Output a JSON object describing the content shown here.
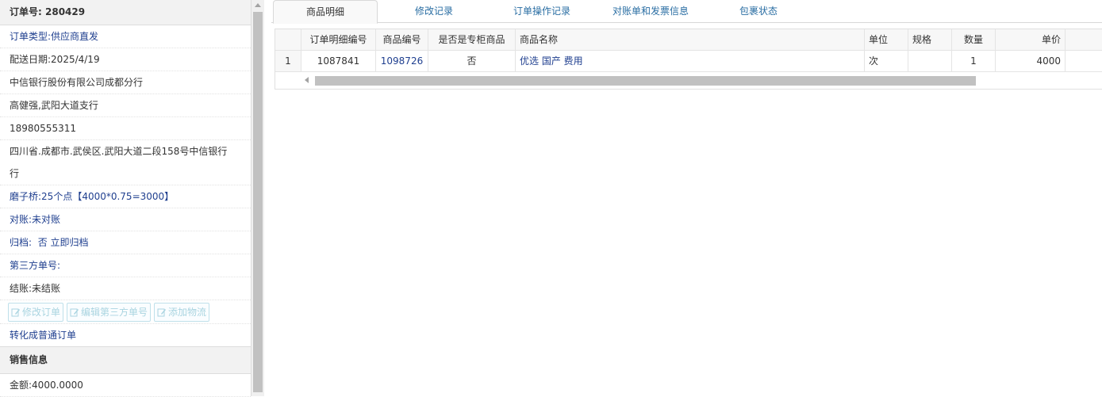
{
  "left": {
    "order_no_label": "订单号:",
    "order_no": "280429",
    "order_type": "订单类型:供应商直发",
    "delivery_date": "配送日期:2025/4/19",
    "company": "中信银行股份有限公司成都分行",
    "contact": "高健强,武阳大道支行",
    "phone": "18980555311",
    "address": "四川省.成都市.武侯区.武阳大道二段158号中信银行",
    "address_cont": "行",
    "station": "磨子桥:25个点【4000*0.75=3000】",
    "reconcile": "对账:未对账",
    "archive_label": "归档:",
    "archive_value": "否",
    "archive_action": "立即归档",
    "third_party": "第三方单号:",
    "settlement": "结账:未结账",
    "buttons": {
      "edit_order": "修改订单",
      "edit_third": "编辑第三方单号",
      "add_logistics": "添加物流"
    },
    "convert": "转化成普通订单",
    "sales_header": "销售信息",
    "amount": "金额:4000.0000"
  },
  "tabs": [
    "商品明细",
    "修改记录",
    "订单操作记录",
    "对账单和发票信息",
    "包裹状态"
  ],
  "grid": {
    "columns": [
      "订单明细编号",
      "商品编号",
      "是否是专柜商品",
      "商品名称",
      "单位",
      "规格",
      "数量",
      "单价"
    ],
    "rows": [
      {
        "index": "1",
        "detail_no": "1087841",
        "product_no": "1098726",
        "counter": "否",
        "name": "优选 国产 费用",
        "unit": "次",
        "spec": "",
        "qty": "1",
        "price": "4000"
      }
    ]
  }
}
